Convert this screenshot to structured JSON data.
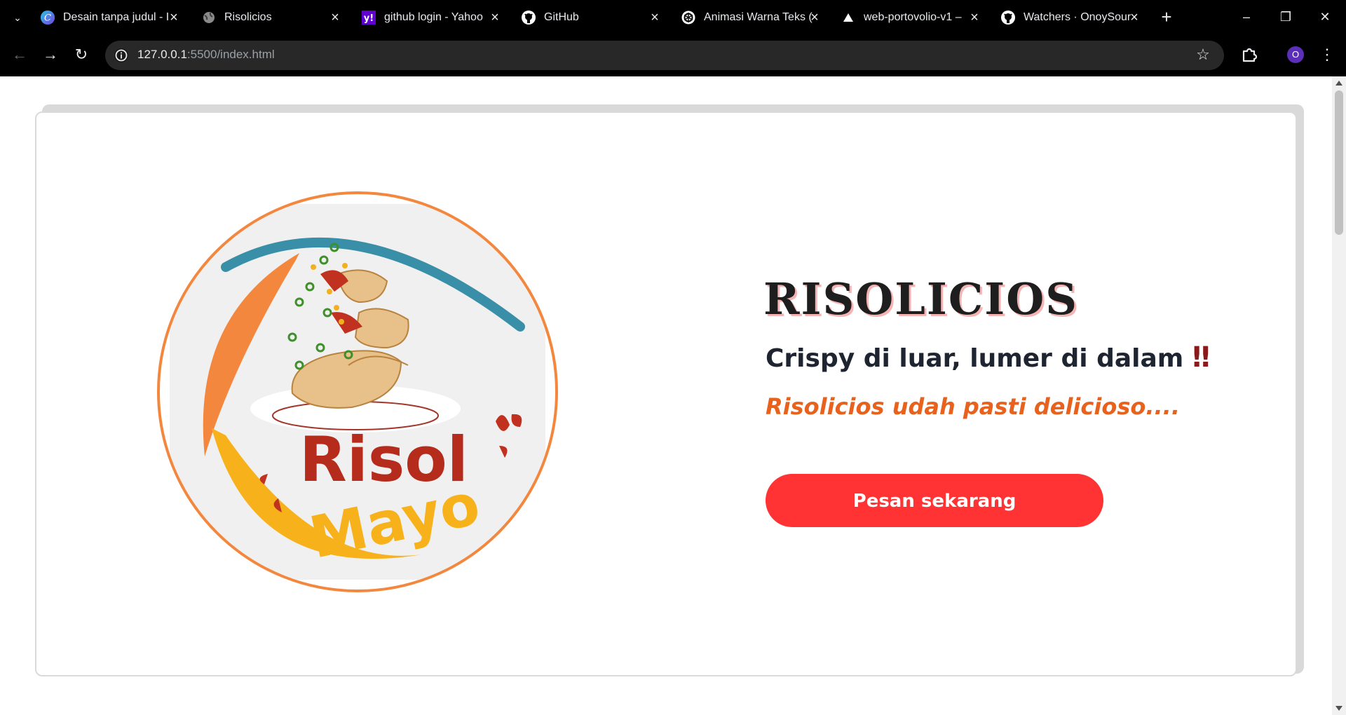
{
  "browser": {
    "tabs": [
      {
        "title": "Desain tanpa judul - I",
        "icon": "canva-icon"
      },
      {
        "title": "Risolicios",
        "icon": "globe-icon"
      },
      {
        "title": "github login - Yahoo",
        "icon": "yahoo-icon"
      },
      {
        "title": "GitHub",
        "icon": "github-icon"
      },
      {
        "title": "Animasi Warna Teks (",
        "icon": "chatgpt-icon"
      },
      {
        "title": "web-portovolio-v1 –",
        "icon": "vercel-icon"
      },
      {
        "title": "Watchers · OnoySour",
        "icon": "github-icon"
      }
    ],
    "new_tab_label": "+",
    "url_host": "127.0.0.1",
    "url_rest": ":5500/index.html",
    "profile_initial": "O"
  },
  "page": {
    "title": "RISOLICIOS",
    "subtitle": "Crispy di luar, lumer di dalam",
    "subtitle_mark": "‼",
    "tagline": "Risolicios udah pasti delicioso....",
    "cta_label": "Pesan sekarang",
    "logo": {
      "word1": "Risol",
      "word2": "Mayo"
    }
  },
  "colors": {
    "accent_button": "#ff3333",
    "tagline": "#e8621d",
    "logo_ring": "#f4873e"
  }
}
